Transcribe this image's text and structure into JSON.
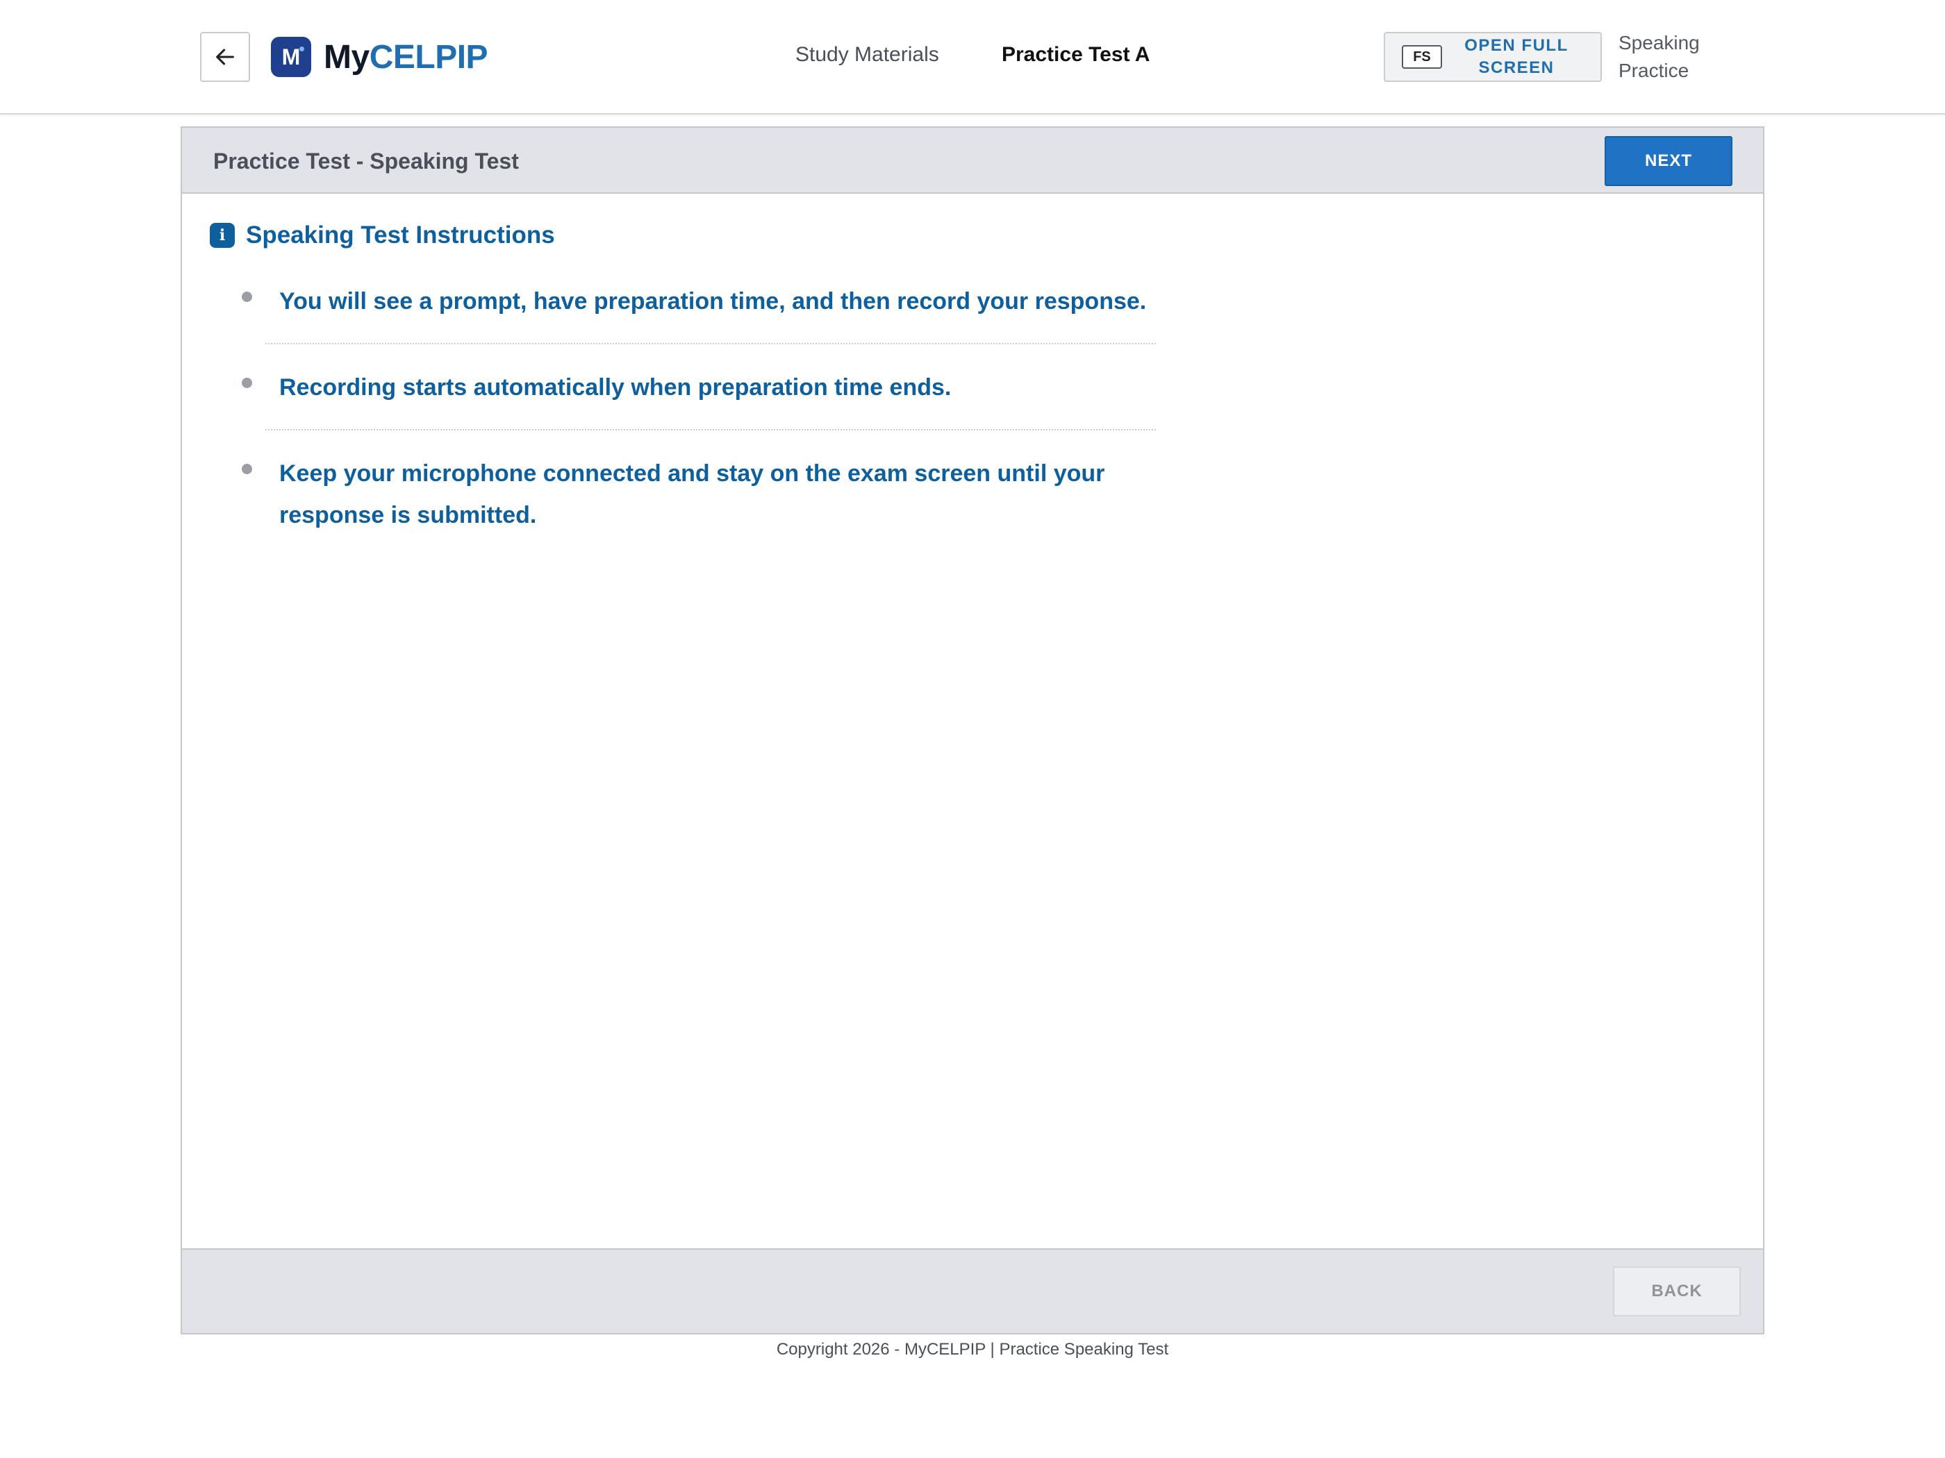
{
  "header": {
    "logo": {
      "prefix": "My",
      "brand": "CELPIP",
      "mark_letter": "M"
    },
    "nav": [
      {
        "label": "Study Materials",
        "active": false
      },
      {
        "label": "Practice Test A",
        "active": true
      }
    ],
    "fullscreen": {
      "key": "FS",
      "label": "OPEN FULL SCREEN"
    },
    "mode_label": "Speaking Practice"
  },
  "panel": {
    "title": "Practice Test - Speaking Test",
    "next_label": "NEXT",
    "back_label": "BACK",
    "instructions": {
      "title": "Speaking Test Instructions",
      "icon": "info-icon",
      "items": [
        "You will see a prompt, have preparation time, and then record your response.",
        "Recording starts automatically when preparation time ends.",
        "Keep your microphone connected and stay on the exam screen until your response is submitted."
      ]
    }
  },
  "footer": {
    "copyright": "Copyright 2026 - MyCELPIP | Practice Speaking Test"
  },
  "colors": {
    "brand_blue": "#1f6fb0",
    "instruction_blue": "#0e5f9e",
    "button_blue": "#1f72c4",
    "panel_gray": "#e1e3e8"
  }
}
